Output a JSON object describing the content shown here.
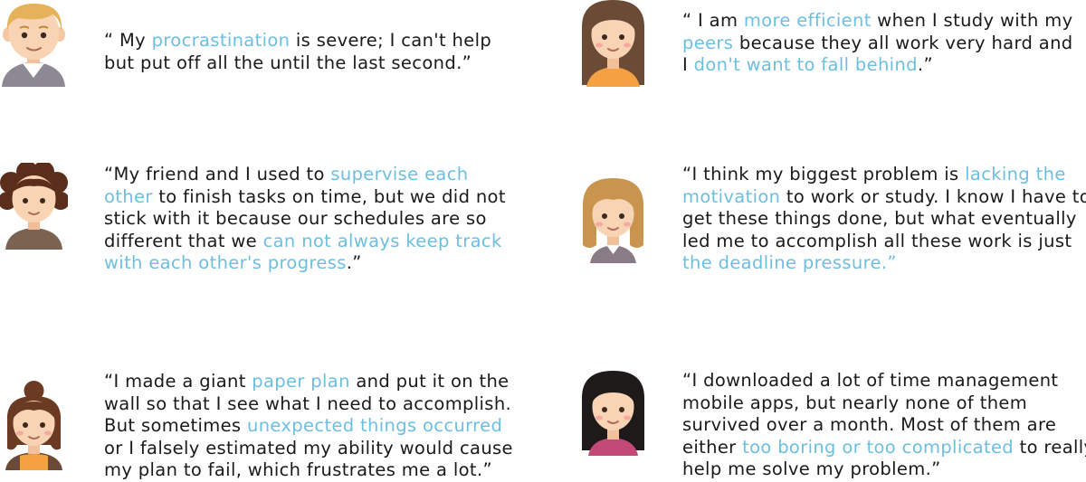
{
  "highlight_color": "#6cbfe0",
  "text_color": "#1a1a1a",
  "quotes": [
    {
      "avatar": "young-man-short-blond-hair",
      "lines": [
        [
          {
            "t": "“ My "
          },
          {
            "t": "procrastination",
            "hl": true
          },
          {
            "t": " is severe; I can't help"
          }
        ],
        [
          {
            "t": "but put off all the until the last second.”"
          }
        ]
      ]
    },
    {
      "avatar": "woman-long-brown-hair-bangs",
      "lines": [
        [
          {
            "t": "“ I am "
          },
          {
            "t": "more efficient",
            "hl": true
          },
          {
            "t": " when I study with my"
          }
        ],
        [
          {
            "t": "peers",
            "hl": true
          },
          {
            "t": " because they all work very hard and"
          }
        ],
        [
          {
            "t": "I "
          },
          {
            "t": "don't want to fall behind",
            "hl": true
          },
          {
            "t": ".”"
          }
        ]
      ]
    },
    {
      "avatar": "man-curly-afro-hair",
      "lines": [
        [
          {
            "t": "“My friend and I used to "
          },
          {
            "t": "supervise each",
            "hl": true
          }
        ],
        [
          {
            "t": "other",
            "hl": true
          },
          {
            "t": " to finish tasks on time, but we did not"
          }
        ],
        [
          {
            "t": "stick with it because our schedules are so"
          }
        ],
        [
          {
            "t": "different that we "
          },
          {
            "t": "can not always keep track",
            "hl": true
          }
        ],
        [
          {
            "t": "with each other's progress",
            "hl": true
          },
          {
            "t": ".”"
          }
        ]
      ]
    },
    {
      "avatar": "girl-blonde-bob-hair",
      "lines": [
        [
          {
            "t": "“I think my biggest problem is "
          },
          {
            "t": "lacking the",
            "hl": true
          }
        ],
        [
          {
            "t": "motivation",
            "hl": true
          },
          {
            "t": " to work or study. I know I have to"
          }
        ],
        [
          {
            "t": "get these things done, but what eventually"
          }
        ],
        [
          {
            "t": "led me to accomplish all these work is just"
          }
        ],
        [
          {
            "t": "the deadline pressure.”",
            "hl": true
          }
        ]
      ]
    },
    {
      "avatar": "woman-brown-hair-bun",
      "lines": [
        [
          {
            "t": "“I made a giant "
          },
          {
            "t": "paper plan",
            "hl": true
          },
          {
            "t": " and  put it on the"
          }
        ],
        [
          {
            "t": "wall so that I see what I need to accomplish."
          }
        ],
        [
          {
            "t": "But sometimes "
          },
          {
            "t": "unexpected things occurred",
            "hl": true
          }
        ],
        [
          {
            "t": "or I falsely estimated my ability would cause"
          }
        ],
        [
          {
            "t": "my plan to fail, which frustrates me a lot.”"
          }
        ]
      ]
    },
    {
      "avatar": "woman-black-long-hair-bangs",
      "lines": [
        [
          {
            "t": "“I downloaded a lot of time management"
          }
        ],
        [
          {
            "t": "mobile apps, but nearly none of them"
          }
        ],
        [
          {
            "t": "survived over a month. Most of them are"
          }
        ],
        [
          {
            "t": "either "
          },
          {
            "t": "too boring or too complicated",
            "hl": true
          },
          {
            "t": " to really"
          }
        ],
        [
          {
            "t": "help me solve my problem.”"
          }
        ]
      ]
    }
  ]
}
